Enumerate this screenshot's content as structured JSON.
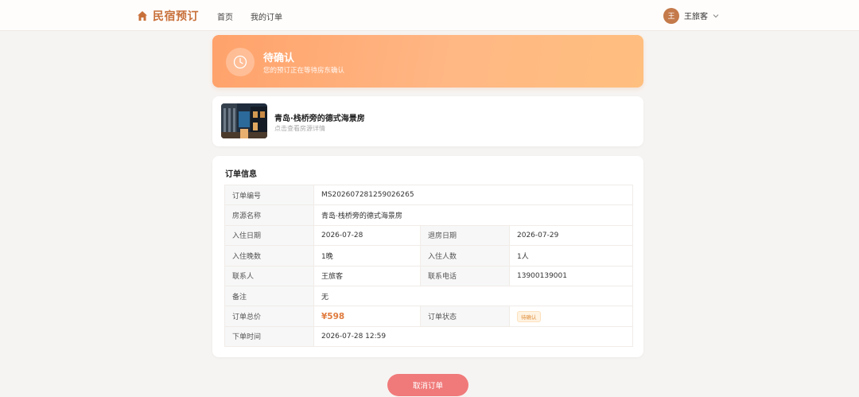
{
  "header": {
    "brand": "民宿预订",
    "nav": [
      {
        "label": "首页"
      },
      {
        "label": "我的订单"
      }
    ],
    "user": {
      "avatar_initial": "王",
      "name": "王旅客"
    }
  },
  "status": {
    "title": "待确认",
    "subtitle": "您的预订正在等待房东确认"
  },
  "listing": {
    "title": "青岛·栈桥旁的德式海景房",
    "subtitle": "点击查看房源详情"
  },
  "order_info": {
    "title": "订单信息",
    "rows": {
      "order_no": {
        "label": "订单编号",
        "value": "MS202607281259026265"
      },
      "listing_name": {
        "label": "房源名称",
        "value": "青岛·栈桥旁的德式海景房"
      },
      "check_in": {
        "label": "入住日期",
        "value": "2026-07-28"
      },
      "check_out": {
        "label": "退房日期",
        "value": "2026-07-29"
      },
      "nights": {
        "label": "入住晚数",
        "value": "1晚"
      },
      "guests": {
        "label": "入住人数",
        "value": "1人"
      },
      "contact": {
        "label": "联系人",
        "value": "王旅客"
      },
      "phone": {
        "label": "联系电话",
        "value": "13900139001"
      },
      "note": {
        "label": "备注",
        "value": "无"
      },
      "total": {
        "label": "订单总价",
        "value": "¥598"
      },
      "order_status": {
        "label": "订单状态",
        "value": "待确认"
      },
      "order_time": {
        "label": "下单时间",
        "value": "2026-07-28 12:59"
      }
    }
  },
  "actions": {
    "cancel_label": "取消订单"
  },
  "colors": {
    "brand": "#c8703a",
    "banner_start": "#ffa26b",
    "banner_end": "#ffbf7f",
    "price": "#e07b3e",
    "cancel_button": "#f07a7a"
  },
  "icons": {
    "brand": "home-icon",
    "status": "clock-icon",
    "user_menu": "chevron-down-icon"
  }
}
